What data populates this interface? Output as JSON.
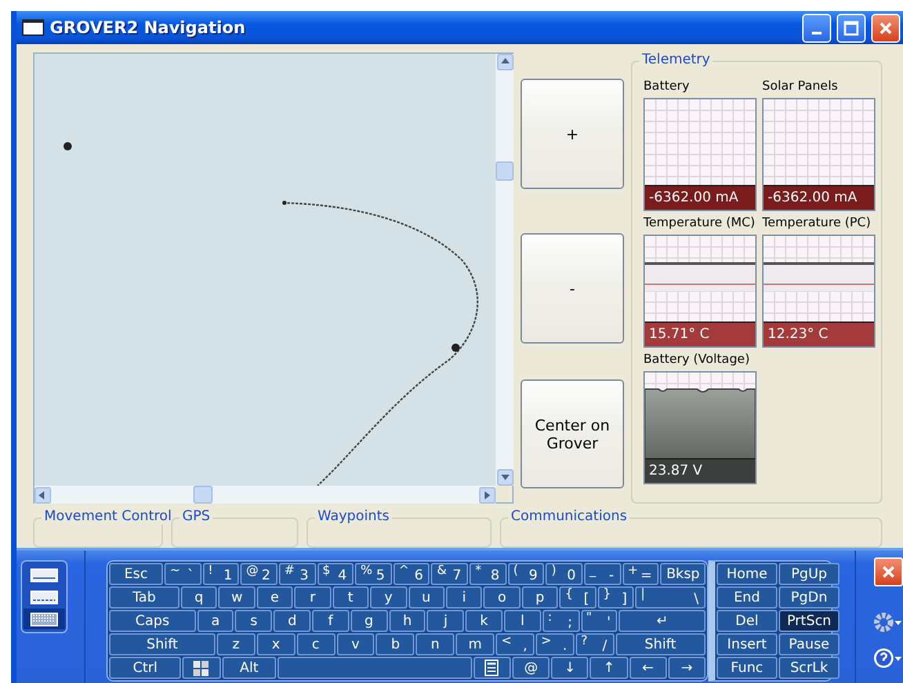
{
  "window": {
    "title": "GROVER2 Navigation"
  },
  "map_buttons": [
    "+",
    "-",
    "Center on Grover"
  ],
  "telemetry": {
    "title": "Telemetry",
    "gauges": [
      {
        "label": "Battery",
        "reading": "-6362.00 mA",
        "kind": "blank",
        "color": "#7b1c1c"
      },
      {
        "label": "Solar Panels",
        "reading": "-6362.00 mA",
        "kind": "blank",
        "color": "#7b1c1c"
      },
      {
        "label": "Temperature (MC)",
        "reading": "15.71° C",
        "kind": "trace",
        "color": "#a33b3b"
      },
      {
        "label": "Temperature (PC)",
        "reading": "12.23° C",
        "kind": "trace",
        "color": "#a33b3b"
      },
      {
        "label": "Battery (Voltage)",
        "reading": "23.87 V",
        "kind": "fill",
        "color": "#3c3f3d"
      }
    ]
  },
  "groups": [
    "Movement Control",
    "GPS",
    "Waypoints",
    "Communications"
  ],
  "keyboard": {
    "modes": [
      {
        "selected": false
      },
      {
        "selected": false
      },
      {
        "selected": true
      }
    ],
    "rows": [
      {
        "keys": [
          {
            "main": "Esc",
            "kind": "mid"
          },
          {
            "shift": "~",
            "main": "`",
            "kind": "key"
          },
          {
            "shift": "!",
            "main": "1",
            "kind": "key"
          },
          {
            "shift": "@",
            "main": "2",
            "kind": "key"
          },
          {
            "shift": "#",
            "main": "3",
            "kind": "key"
          },
          {
            "shift": "$",
            "main": "4",
            "kind": "key"
          },
          {
            "shift": "%",
            "main": "5",
            "kind": "key"
          },
          {
            "shift": "^",
            "main": "6",
            "kind": "key"
          },
          {
            "shift": "&",
            "main": "7",
            "kind": "key"
          },
          {
            "shift": "*",
            "main": "8",
            "kind": "key"
          },
          {
            "shift": "(",
            "main": "9",
            "kind": "key"
          },
          {
            "shift": ")",
            "main": "0",
            "kind": "key"
          },
          {
            "shift": "_",
            "main": "-",
            "kind": "key"
          },
          {
            "shift": "+",
            "main": "=",
            "kind": "key"
          },
          {
            "main": "Bksp",
            "kind": "short"
          }
        ]
      },
      {
        "keys": [
          {
            "main": "Tab",
            "kind": "wide"
          },
          {
            "main": "q",
            "kind": "key"
          },
          {
            "main": "w",
            "kind": "key"
          },
          {
            "main": "e",
            "kind": "key"
          },
          {
            "main": "r",
            "kind": "key"
          },
          {
            "main": "t",
            "kind": "key"
          },
          {
            "main": "y",
            "kind": "key"
          },
          {
            "main": "u",
            "kind": "key"
          },
          {
            "main": "i",
            "kind": "key"
          },
          {
            "main": "o",
            "kind": "key"
          },
          {
            "main": "p",
            "kind": "key"
          },
          {
            "shift": "{",
            "main": "[",
            "kind": "key"
          },
          {
            "shift": "}",
            "main": "]",
            "kind": "key"
          },
          {
            "shift": "|",
            "main": "\\",
            "kind": "wide"
          }
        ]
      },
      {
        "keys": [
          {
            "main": "Caps",
            "kind": "wider"
          },
          {
            "main": "a",
            "kind": "key"
          },
          {
            "main": "s",
            "kind": "key"
          },
          {
            "main": "d",
            "kind": "key"
          },
          {
            "main": "f",
            "kind": "key"
          },
          {
            "main": "g",
            "kind": "key"
          },
          {
            "main": "h",
            "kind": "key"
          },
          {
            "main": "j",
            "kind": "key"
          },
          {
            "main": "k",
            "kind": "key"
          },
          {
            "main": "l",
            "kind": "key"
          },
          {
            "shift": ":",
            "main": ";",
            "kind": "key"
          },
          {
            "shift": "\"",
            "main": "'",
            "kind": "key"
          },
          {
            "main": "↵",
            "kind": "wider"
          }
        ]
      },
      {
        "keys": [
          {
            "main": "Shift",
            "kind": "widest"
          },
          {
            "main": "z",
            "kind": "key"
          },
          {
            "main": "x",
            "kind": "key"
          },
          {
            "main": "c",
            "kind": "key"
          },
          {
            "main": "v",
            "kind": "key"
          },
          {
            "main": "b",
            "kind": "key"
          },
          {
            "main": "n",
            "kind": "key"
          },
          {
            "main": "m",
            "kind": "key"
          },
          {
            "shift": "<",
            "main": ",",
            "kind": "key"
          },
          {
            "shift": ">",
            "main": ".",
            "kind": "key"
          },
          {
            "shift": "?",
            "main": "/",
            "kind": "key"
          },
          {
            "main": "Shift",
            "kind": "wider"
          }
        ]
      },
      {
        "keys": [
          {
            "main": "Ctrl",
            "kind": "wide"
          },
          {
            "kind": "windows"
          },
          {
            "main": "Alt",
            "kind": "mid"
          },
          {
            "kind": "space"
          },
          {
            "kind": "menu"
          },
          {
            "main": "@",
            "kind": "key"
          },
          {
            "main": "↓",
            "kind": "key"
          },
          {
            "main": "↑",
            "kind": "key"
          },
          {
            "main": "←",
            "kind": "key"
          },
          {
            "main": "→",
            "kind": "key"
          }
        ]
      }
    ],
    "side_keys": [
      {
        "label": "Home",
        "pressed": false
      },
      {
        "label": "PgUp",
        "pressed": false
      },
      {
        "label": "End",
        "pressed": false
      },
      {
        "label": "PgDn",
        "pressed": false
      },
      {
        "label": "Del",
        "pressed": false
      },
      {
        "label": "PrtScn",
        "pressed": true
      },
      {
        "label": "Insert",
        "pressed": false
      },
      {
        "label": "Pause",
        "pressed": false
      },
      {
        "label": "Func",
        "pressed": false
      },
      {
        "label": "ScrLk",
        "pressed": false
      }
    ]
  }
}
